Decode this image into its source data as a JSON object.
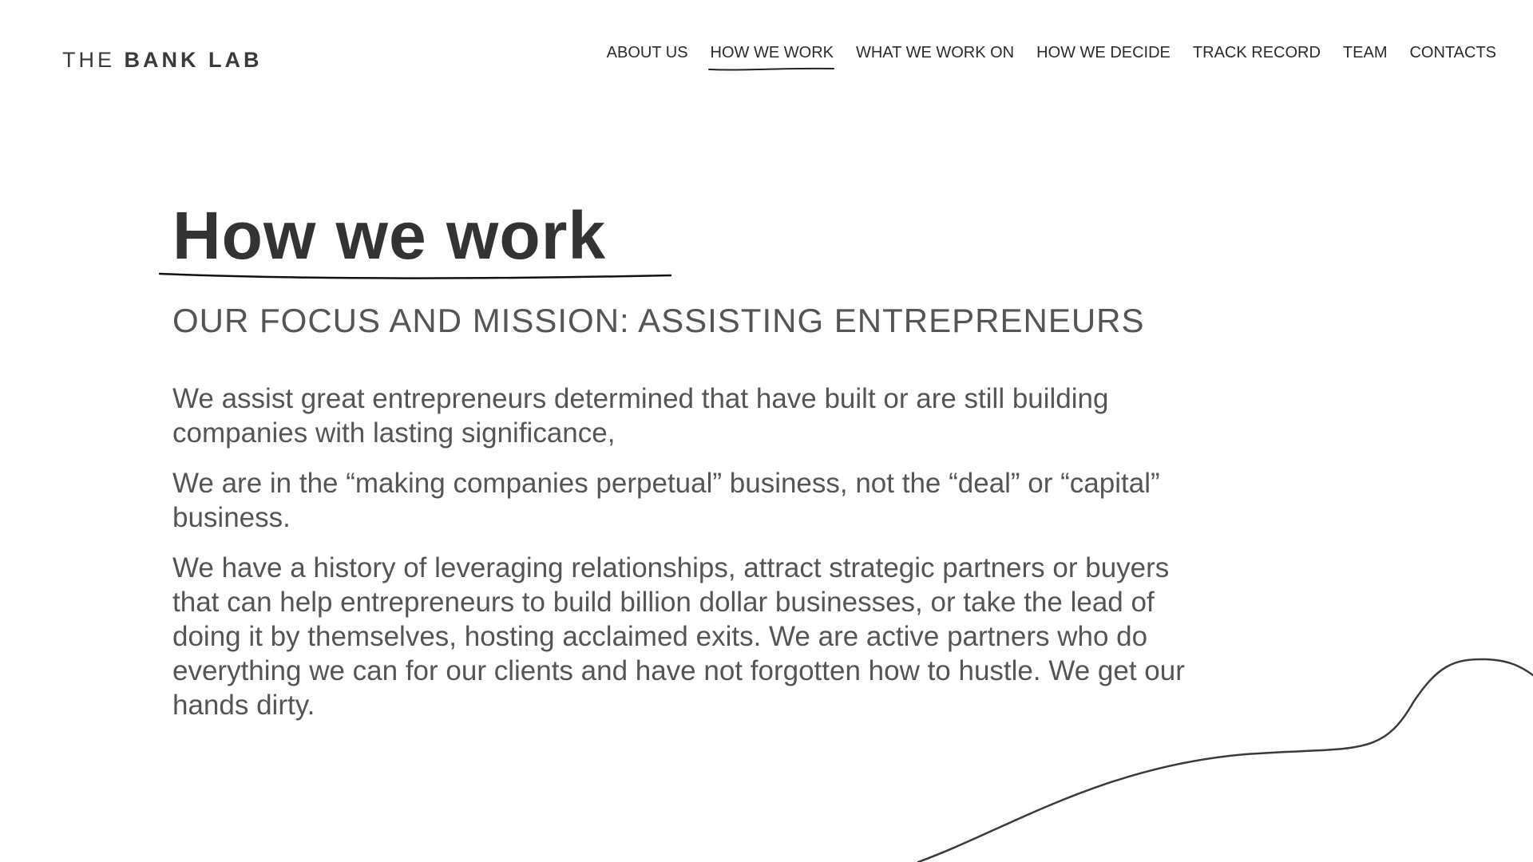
{
  "logo": {
    "the": "THE",
    "bank_lab": "BANK LAB"
  },
  "nav": {
    "items": [
      {
        "label": "ABOUT US"
      },
      {
        "label": "HOW WE WORK",
        "active": true
      },
      {
        "label": "WHAT WE WORK ON"
      },
      {
        "label": "HOW WE DECIDE"
      },
      {
        "label": "TRACK RECORD"
      },
      {
        "label": "TEAM"
      },
      {
        "label": "CONTACTS"
      }
    ]
  },
  "main": {
    "title": "How we work",
    "subtitle": "OUR FOCUS AND MISSION: ASSISTING ENTREPRENEURS",
    "paragraphs": [
      "We assist great entrepreneurs determined that have built or are still building companies with lasting significance,",
      "We are in the “making companies perpetual”  business, not the “deal” or “capital” business.",
      "We have a history of leveraging relationships, attract strategic partners or buyers that can help entrepreneurs to build billion dollar businesses, or take the lead of doing it by themselves, hosting acclaimed exits. We are active partners who do everything we can for our clients and have not forgotten how to hustle. We get our hands dirty."
    ]
  },
  "colors": {
    "text_dark": "#333333",
    "text_muted": "#555555",
    "background": "#ffffff",
    "line": "#3a3a3a"
  }
}
